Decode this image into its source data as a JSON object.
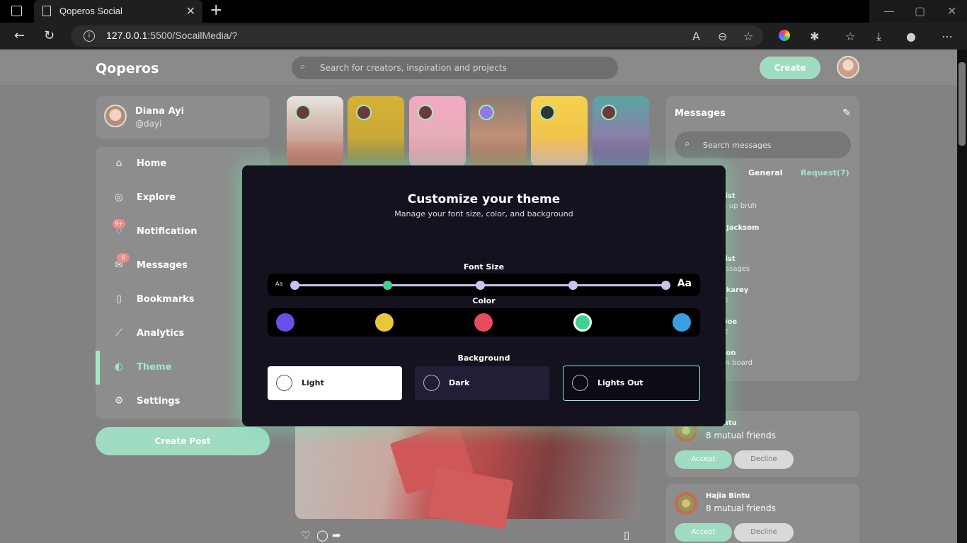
{
  "browser": {
    "tab_title": "Qoperos Social",
    "tab_close": "✕",
    "new_tab": "+",
    "url_host": "127.0.0.1",
    "url_rest": ":5500/SocailMedia/?",
    "win_min": "—",
    "win_max": "▢",
    "win_close": "✕"
  },
  "topnav": {
    "logo": "Qoperos",
    "search_placeholder": "Search for creators, inspiration and projects",
    "create_label": "Create"
  },
  "profile": {
    "name": "Diana Ayi",
    "handle": "@dayi"
  },
  "sidebar": {
    "items": [
      {
        "label": "Home",
        "icon": "home-icon"
      },
      {
        "label": "Explore",
        "icon": "compass-icon"
      },
      {
        "label": "Notification",
        "icon": "bell-icon",
        "badge": "9+"
      },
      {
        "label": "Messages",
        "icon": "mail-icon",
        "badge": "6"
      },
      {
        "label": "Bookmarks",
        "icon": "bookmark-icon"
      },
      {
        "label": "Analytics",
        "icon": "chart-icon"
      },
      {
        "label": "Theme",
        "icon": "palette-icon",
        "active": true
      },
      {
        "label": "Settings",
        "icon": "gear-icon"
      }
    ],
    "create_post": "Create Post"
  },
  "messages": {
    "title": "Messages",
    "search_placeholder": "Search messages",
    "tabs": [
      "General",
      "Request(7)"
    ],
    "items": [
      {
        "name": "Quist",
        "text": "oke up bruh"
      },
      {
        "name": "ila Jacksom",
        "text": "e u"
      },
      {
        "name": "Quist",
        "text": "messages"
      },
      {
        "name": "Makarey",
        "text": "ight"
      },
      {
        "name": "e Doe",
        "text": "ight"
      },
      {
        "name": "mson",
        "text": "u on board"
      }
    ]
  },
  "requests": [
    {
      "name": "ja Bintu",
      "mutual": "8 mutual friends",
      "accept": "Accept",
      "decline": "Decline"
    },
    {
      "name": "Hajia Bintu",
      "mutual": "8 mutual friends",
      "accept": "Accept",
      "decline": "Decline"
    }
  ],
  "modal": {
    "title": "Customize your theme",
    "subtitle": "Manage your font size, color, and background",
    "font_size_label": "Font Size",
    "font_small": "Aa",
    "font_large": "Aa",
    "font_selected_step": 2,
    "color_label": "Color",
    "colors": [
      "#6b4ee6",
      "#e6c93a",
      "#e84a5f",
      "#3fd28f",
      "#3a9ee2"
    ],
    "selected_color": "#3fd28f",
    "background_label": "Background",
    "backgrounds": [
      "Light",
      "Dark",
      "Lights Out"
    ],
    "selected_background": "Lights Out"
  }
}
